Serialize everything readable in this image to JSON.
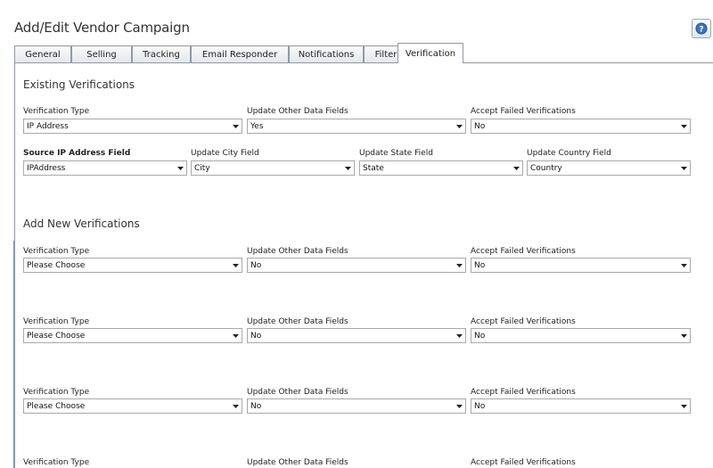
{
  "page": {
    "title": "Add/Edit Vendor Campaign"
  },
  "help": {
    "icon": "help-icon"
  },
  "tabs": [
    {
      "label": "General"
    },
    {
      "label": "Selling"
    },
    {
      "label": "Tracking"
    },
    {
      "label": "Email Responder"
    },
    {
      "label": "Notifications"
    },
    {
      "label": "Filter"
    },
    {
      "label": "Verification",
      "active": true
    }
  ],
  "existing": {
    "title": "Existing Verifications",
    "row1": {
      "type_label": "Verification Type",
      "type_value": "IP Address",
      "update_label": "Update Other Data Fields",
      "update_value": "Yes",
      "accept_label": "Accept Failed Verifications",
      "accept_value": "No"
    },
    "row2": {
      "source_label": "Source IP Address Field",
      "source_value": "IPAddress",
      "city_label": "Update City Field",
      "city_value": "City",
      "state_label": "Update State Field",
      "state_value": "State",
      "country_label": "Update Country Field",
      "country_value": "Country"
    }
  },
  "add_new": {
    "title": "Add New Verifications",
    "rows": [
      {
        "type_label": "Verification Type",
        "type_value": "Please Choose",
        "update_label": "Update Other Data Fields",
        "update_value": "No",
        "accept_label": "Accept Failed Verifications",
        "accept_value": "No"
      },
      {
        "type_label": "Verification Type",
        "type_value": "Please Choose",
        "update_label": "Update Other Data Fields",
        "update_value": "No",
        "accept_label": "Accept Failed Verifications",
        "accept_value": "No"
      },
      {
        "type_label": "Verification Type",
        "type_value": "Please Choose",
        "update_label": "Update Other Data Fields",
        "update_value": "No",
        "accept_label": "Accept Failed Verifications",
        "accept_value": "No"
      },
      {
        "type_label": "Verification Type",
        "update_label": "Update Other Data Fields",
        "accept_label": "Accept Failed Verifications"
      }
    ]
  },
  "colors": {
    "accent_line": "#6a9ad6",
    "border": "#8f9aa6"
  }
}
